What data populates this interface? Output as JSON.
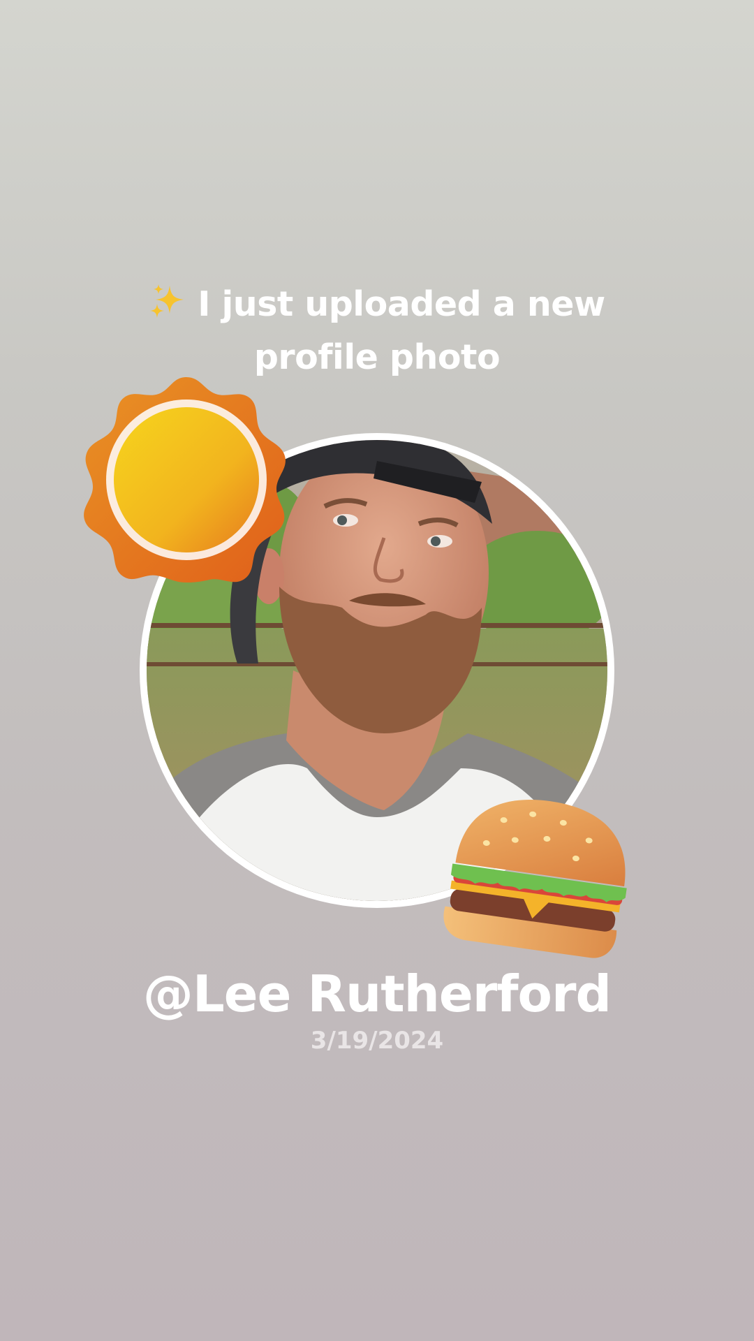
{
  "post": {
    "headline_line1": "I just uploaded a new",
    "headline_line2": "profile photo",
    "username": "@Lee Rutherford",
    "date": "3/19/2024"
  },
  "icons": {
    "headline_icon": "sparkles-icon",
    "top_left_sticker": "sun-icon",
    "bottom_right_sticker": "hamburger-icon"
  },
  "colors": {
    "background_top": "#d4d5cf",
    "background_bottom": "#c0b6ba",
    "text": "#ffffff",
    "date_text": "#e9e5e6",
    "sun_outer": "#e8791a",
    "sun_inner": "#f5c41c"
  }
}
